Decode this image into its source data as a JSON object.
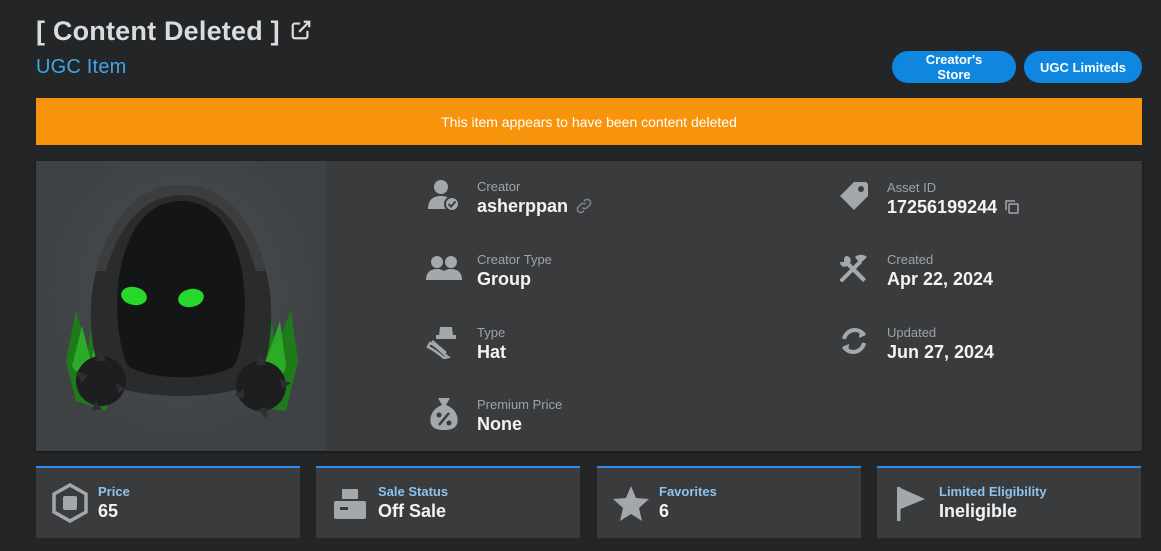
{
  "header": {
    "title": "[ Content Deleted ]",
    "subtitle": "UGC Item",
    "buttons": {
      "store": "Creator's Store",
      "limiteds": "UGC Limiteds"
    }
  },
  "banner": {
    "text": "This item appears to have been content deleted"
  },
  "details": {
    "creator": {
      "label": "Creator",
      "value": "asherppan",
      "icon": "user-verified-icon"
    },
    "creator_type": {
      "label": "Creator Type",
      "value": "Group",
      "icon": "group-icon"
    },
    "type": {
      "label": "Type",
      "value": "Hat",
      "icon": "hat-icon"
    },
    "premium_price": {
      "label": "Premium Price",
      "value": "None",
      "icon": "discount-bag-icon"
    },
    "asset_id": {
      "label": "Asset ID",
      "value": "17256199244",
      "icon": "tag-icon"
    },
    "created": {
      "label": "Created",
      "value": "Apr 22, 2024",
      "icon": "tools-icon"
    },
    "updated": {
      "label": "Updated",
      "value": "Jun 27, 2024",
      "icon": "sync-icon"
    }
  },
  "stats": [
    {
      "label": "Price",
      "value": "65",
      "icon": "robux-icon"
    },
    {
      "label": "Sale Status",
      "value": "Off Sale",
      "icon": "register-icon"
    },
    {
      "label": "Favorites",
      "value": "6",
      "icon": "star-icon"
    },
    {
      "label": "Limited Eligibility",
      "value": "Ineligible",
      "icon": "flag-icon"
    }
  ],
  "colors": {
    "background": "#232527",
    "card": "#393b3d",
    "accent_blue": "#0f86e0",
    "banner_orange": "#f7940c",
    "link_blue": "#3fa6e6"
  }
}
